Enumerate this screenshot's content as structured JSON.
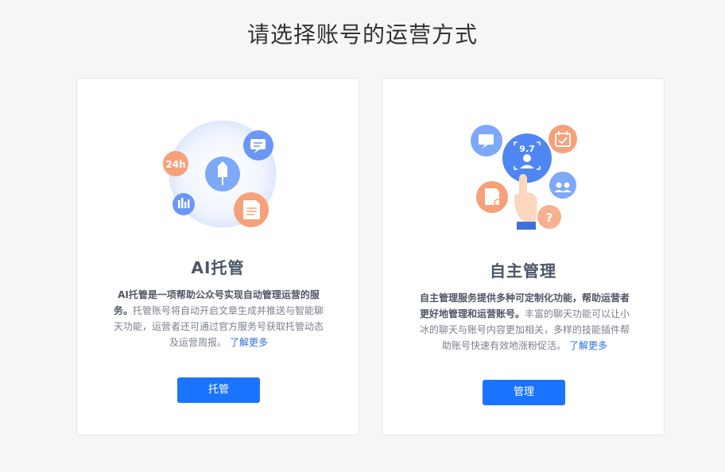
{
  "page": {
    "title": "请选择账号的运营方式"
  },
  "cards": {
    "ai": {
      "title": "AI托管",
      "desc_bold": "AI托管是一项帮助公众号实现自动管理运营的服务。",
      "desc_rest": "托管账号将自动开启文章生成并推送与智能聊天功能，运营者还可通过官方服务号获取托管动态及运营周报。",
      "link": "了解更多",
      "button": "托管",
      "badge_24h": "24h"
    },
    "self": {
      "title": "自主管理",
      "desc_bold": "自主管理服务提供多种可定制化功能，帮助运营者更好地管理和运营账号。",
      "desc_rest": "丰富的聊天功能可以让小冰的聊天与账号内容更加相关，多样的技能插件帮助账号快速有效地涨粉促活。",
      "link": "了解更多",
      "button": "管理",
      "score": "9.7",
      "question_mark": "?"
    }
  },
  "colors": {
    "primary": "#1a74ff",
    "orange": "#f7a07a",
    "blue": "#6b97f5",
    "link": "#2c6fe0"
  }
}
